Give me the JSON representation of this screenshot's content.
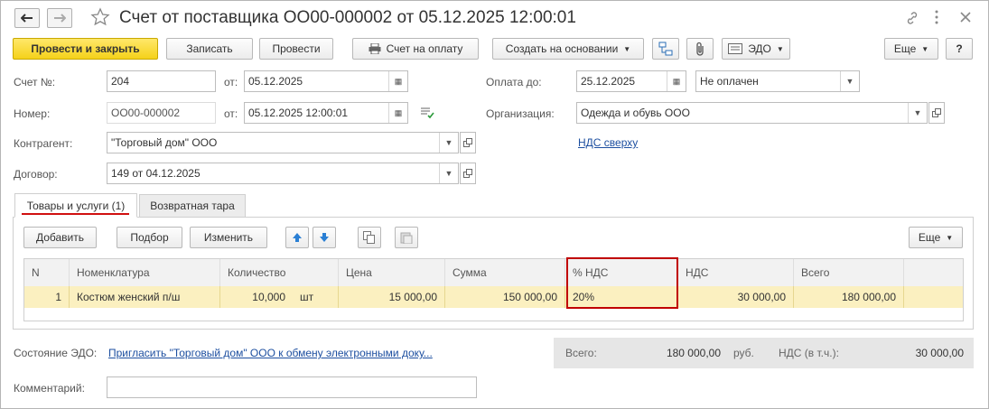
{
  "window": {
    "title": "Счет от поставщика ОО00-000002 от 05.12.2025 12:00:01"
  },
  "toolbar": {
    "post_close": "Провести и закрыть",
    "save": "Записать",
    "post": "Провести",
    "invoice": "Счет на оплату",
    "create_based": "Создать на основании",
    "edo": "ЭДО",
    "more": "Еще",
    "help": "?"
  },
  "form": {
    "invoice_no_label": "Счет №:",
    "invoice_no": "204",
    "from_label": "от:",
    "invoice_date": "05.12.2025",
    "number_label": "Номер:",
    "number": "ОО00-000002",
    "number_date": "05.12.2025 12:00:01",
    "counterparty_label": "Контрагент:",
    "counterparty": "\"Торговый дом\" ООО",
    "contract_label": "Договор:",
    "contract": "149 от 04.12.2025",
    "pay_until_label": "Оплата до:",
    "pay_until": "25.12.2025",
    "pay_status": "Не оплачен",
    "org_label": "Организация:",
    "org": "Одежда и обувь ООО",
    "vat_link": "НДС сверху"
  },
  "tabs": [
    {
      "label": "Товары и услуги (1)"
    },
    {
      "label": "Возвратная тара"
    }
  ],
  "table_toolbar": {
    "add": "Добавить",
    "pick": "Подбор",
    "change": "Изменить",
    "more": "Еще"
  },
  "table": {
    "headers": [
      "N",
      "Номенклатура",
      "Количество",
      "Цена",
      "Сумма",
      "% НДС",
      "НДС",
      "Всего"
    ],
    "rows": [
      {
        "n": "1",
        "item": "Костюм женский п/ш",
        "qty": "10,000",
        "unit": "шт",
        "price": "15 000,00",
        "sum": "150 000,00",
        "vat_rate": "20%",
        "vat": "30 000,00",
        "total": "180 000,00"
      }
    ]
  },
  "footer": {
    "edo_state_label": "Состояние ЭДО:",
    "edo_link": "Пригласить \"Торговый дом\" ООО к обмену электронными доку...",
    "total_label": "Всего:",
    "total": "180 000,00",
    "currency": "руб.",
    "vat_label": "НДС (в т.ч.):",
    "vat": "30 000,00",
    "comment_label": "Комментарий:",
    "comment": ""
  },
  "colors": {
    "primary_button": "#f5d21a",
    "selected_row": "#fbf0c0",
    "highlight_box": "#c00000",
    "link": "#1d4fa0",
    "tab_underline": "#d01010"
  }
}
